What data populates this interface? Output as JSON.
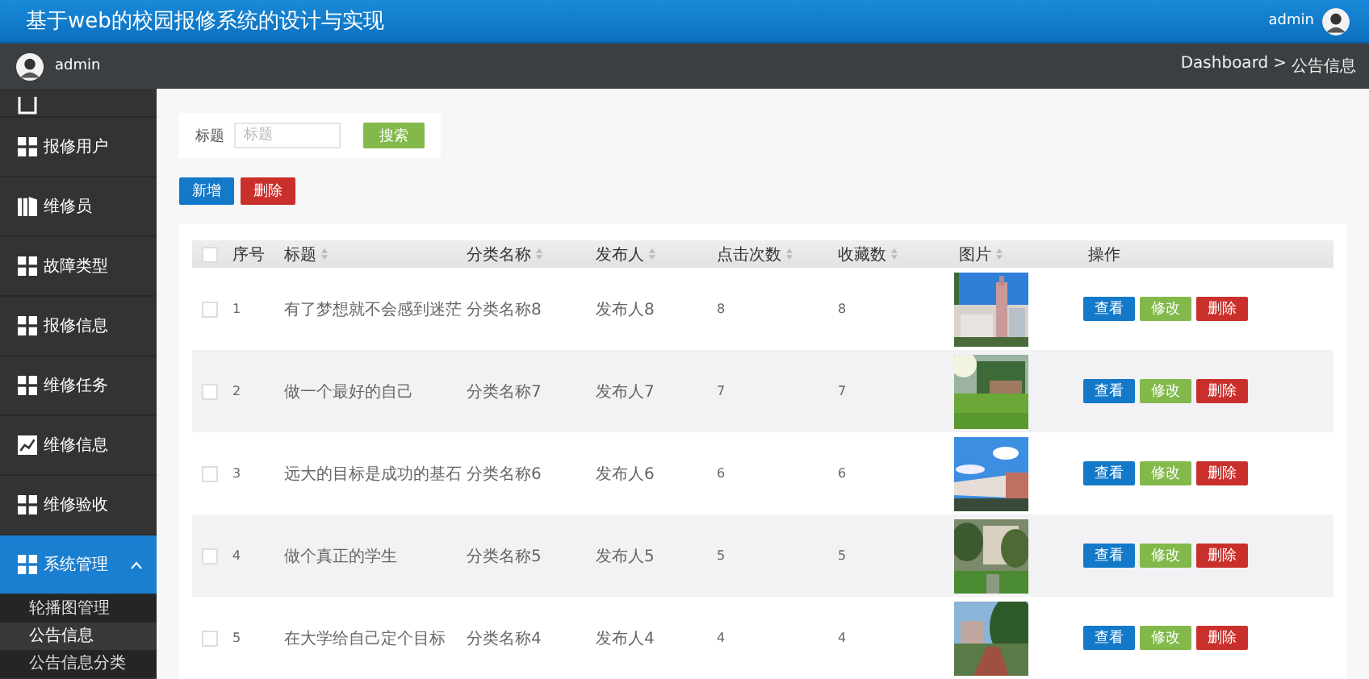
{
  "header": {
    "title": "基于web的校园报修系统的设计与实现",
    "user": "admin"
  },
  "topbar": {
    "user": "admin",
    "breadcrumb": [
      "Dashboard",
      "公告信息"
    ],
    "separator": ">"
  },
  "sidebar": {
    "items": [
      {
        "label": "报修用户",
        "kind": "grid",
        "selected": false
      },
      {
        "label": "维修员",
        "kind": "bars",
        "selected": false
      },
      {
        "label": "故障类型",
        "kind": "grid",
        "selected": false
      },
      {
        "label": "报修信息",
        "kind": "grid",
        "selected": false
      },
      {
        "label": "维修任务",
        "kind": "grid",
        "selected": false
      },
      {
        "label": "维修信息",
        "kind": "chart",
        "selected": false
      },
      {
        "label": "维修验收",
        "kind": "grid",
        "selected": false
      },
      {
        "label": "系统管理",
        "kind": "grid",
        "selected": true,
        "expanded": true,
        "children": [
          {
            "label": "轮播图管理",
            "selected": false
          },
          {
            "label": "公告信息",
            "selected": true
          },
          {
            "label": "公告信息分类",
            "selected": false
          }
        ]
      }
    ]
  },
  "search": {
    "label": "标题",
    "placeholder": "标题",
    "button": "搜索"
  },
  "actions": [
    {
      "label": "新增",
      "kind": "primary"
    },
    {
      "label": "删除",
      "kind": "danger"
    }
  ],
  "table": {
    "select_all": false,
    "columns": [
      {
        "label": "序号",
        "sortable": false
      },
      {
        "label": "标题",
        "sortable": true
      },
      {
        "label": "分类名称",
        "sortable": true
      },
      {
        "label": "发布人",
        "sortable": true
      },
      {
        "label": "点击次数",
        "sortable": true
      },
      {
        "label": "收藏数",
        "sortable": true
      },
      {
        "label": "图片",
        "sortable": true
      },
      {
        "label": "操作",
        "sortable": false
      }
    ],
    "rows": [
      {
        "checked": false,
        "cells": [
          "1",
          "有了梦想就不会感到迷茫",
          "分类名称8",
          "发布人8",
          "8",
          "8"
        ],
        "actions": [
          {
            "label": "查看",
            "kind": "primary"
          },
          {
            "label": "修改",
            "kind": "success"
          },
          {
            "label": "删除",
            "kind": "danger"
          }
        ]
      },
      {
        "checked": false,
        "cells": [
          "2",
          "做一个最好的自己",
          "分类名称7",
          "发布人7",
          "7",
          "7"
        ],
        "actions": [
          {
            "label": "查看",
            "kind": "primary"
          },
          {
            "label": "修改",
            "kind": "success"
          },
          {
            "label": "删除",
            "kind": "danger"
          }
        ]
      },
      {
        "checked": false,
        "cells": [
          "3",
          "远大的目标是成功的基石",
          "分类名称6",
          "发布人6",
          "6",
          "6"
        ],
        "actions": [
          {
            "label": "查看",
            "kind": "primary"
          },
          {
            "label": "修改",
            "kind": "success"
          },
          {
            "label": "删除",
            "kind": "danger"
          }
        ]
      },
      {
        "checked": false,
        "cells": [
          "4",
          "做个真正的学生",
          "分类名称5",
          "发布人5",
          "5",
          "5"
        ],
        "actions": [
          {
            "label": "查看",
            "kind": "primary"
          },
          {
            "label": "修改",
            "kind": "success"
          },
          {
            "label": "删除",
            "kind": "danger"
          }
        ]
      },
      {
        "checked": false,
        "cells": [
          "5",
          "在大学给自己定个目标",
          "分类名称4",
          "发布人4",
          "4",
          "4"
        ],
        "actions": [
          {
            "label": "查看",
            "kind": "primary"
          },
          {
            "label": "修改",
            "kind": "success"
          },
          {
            "label": "删除",
            "kind": "danger"
          }
        ]
      }
    ]
  }
}
